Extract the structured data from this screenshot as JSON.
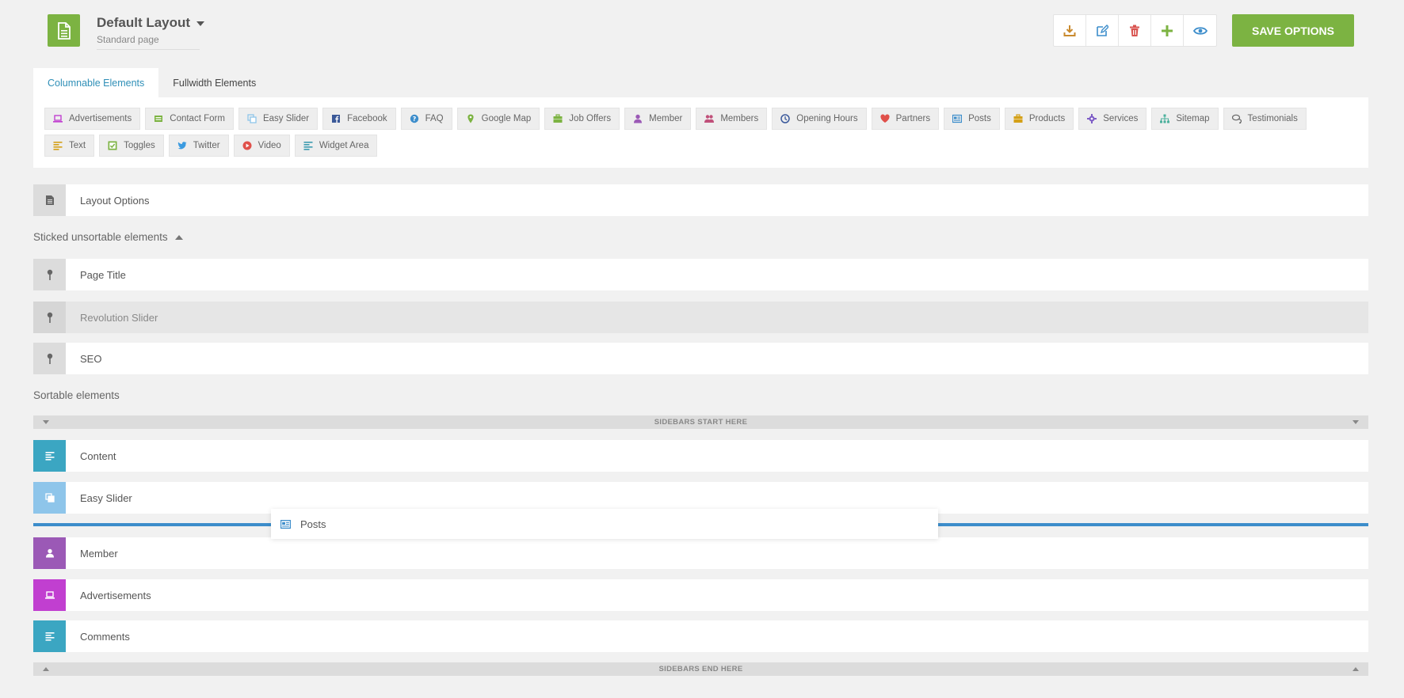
{
  "header": {
    "title": "Default Layout",
    "subtitle": "Standard page",
    "save_label": "SAVE OPTIONS",
    "tools": [
      "download-icon",
      "edit-icon",
      "trash-icon",
      "plus-icon",
      "eye-icon"
    ]
  },
  "tabs": [
    {
      "label": "Columnable Elements",
      "active": true
    },
    {
      "label": "Fullwidth Elements",
      "active": false
    }
  ],
  "elements": [
    {
      "label": "Advertisements",
      "icon": "laptop-icon",
      "color": "#c13fd0"
    },
    {
      "label": "Contact Form",
      "icon": "envelope-icon",
      "color": "#7cb342"
    },
    {
      "label": "Easy Slider",
      "icon": "copy-icon",
      "color": "#8ec5ea"
    },
    {
      "label": "Facebook",
      "icon": "facebook-icon",
      "color": "#3b5998"
    },
    {
      "label": "FAQ",
      "icon": "question-icon",
      "color": "#3c8dcb"
    },
    {
      "label": "Google Map",
      "icon": "map-pin-icon",
      "color": "#7cb342"
    },
    {
      "label": "Job Offers",
      "icon": "briefcase-icon",
      "color": "#7cb342"
    },
    {
      "label": "Member",
      "icon": "user-icon",
      "color": "#9b59b6"
    },
    {
      "label": "Members",
      "icon": "users-icon",
      "color": "#c0507a"
    },
    {
      "label": "Opening Hours",
      "icon": "clock-icon",
      "color": "#3c5a9c"
    },
    {
      "label": "Partners",
      "icon": "heart-icon",
      "color": "#e0504a"
    },
    {
      "label": "Posts",
      "icon": "newspaper-icon",
      "color": "#3c8dcb"
    },
    {
      "label": "Products",
      "icon": "briefcase-icon",
      "color": "#d4a017"
    },
    {
      "label": "Services",
      "icon": "gear-icon",
      "color": "#7d5cc6"
    },
    {
      "label": "Sitemap",
      "icon": "sitemap-icon",
      "color": "#4bb09c"
    },
    {
      "label": "Testimonials",
      "icon": "comments-icon",
      "color": "#666666"
    },
    {
      "label": "Text",
      "icon": "align-left-icon",
      "color": "#d4a017"
    },
    {
      "label": "Toggles",
      "icon": "checkbox-icon",
      "color": "#7cb342"
    },
    {
      "label": "Twitter",
      "icon": "twitter-icon",
      "color": "#3c9be0"
    },
    {
      "label": "Video",
      "icon": "play-icon",
      "color": "#e0504a"
    },
    {
      "label": "Widget Area",
      "icon": "align-left-icon",
      "color": "#3c9bb0"
    }
  ],
  "layout_options": {
    "label": "Layout Options"
  },
  "sticked": {
    "title": "Sticked unsortable elements",
    "items": [
      {
        "label": "Page Title"
      },
      {
        "label": "Revolution Slider"
      },
      {
        "label": "SEO"
      }
    ]
  },
  "sortable": {
    "title": "Sortable elements",
    "start_bar": "SIDEBARS START HERE",
    "end_bar": "SIDEBARS END HERE",
    "items": [
      {
        "label": "Content",
        "icon": "align-left-icon",
        "color": "#3ba6c2"
      },
      {
        "label": "Easy Slider",
        "icon": "copy-icon",
        "color": "#8ec5ea"
      },
      {
        "label": "Member",
        "icon": "user-icon",
        "color": "#9b59b6"
      },
      {
        "label": "Advertisements",
        "icon": "laptop-icon",
        "color": "#c13fd0"
      },
      {
        "label": "Comments",
        "icon": "align-left-icon",
        "color": "#3ba6c2"
      }
    ]
  },
  "dragging": {
    "label": "Posts",
    "icon": "newspaper-icon",
    "color": "#3c8dcb"
  }
}
